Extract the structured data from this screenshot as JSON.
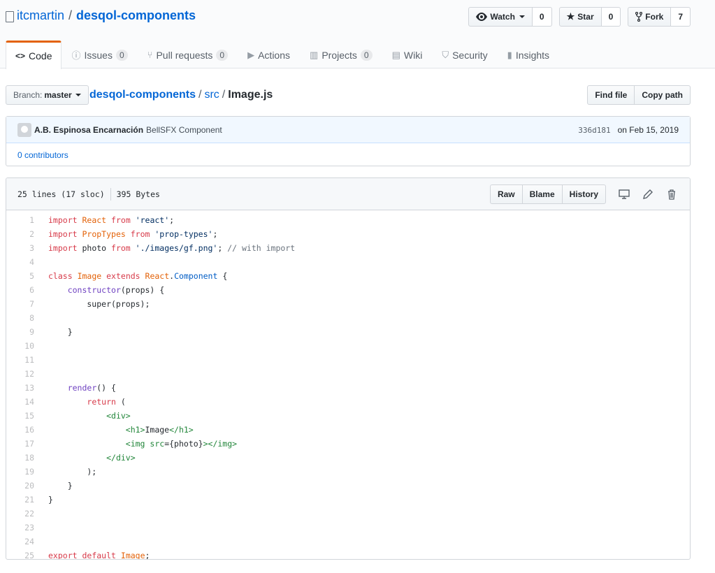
{
  "repo": {
    "owner": "itcmartin",
    "separator": "/",
    "name": "desqol-components"
  },
  "actions": {
    "watch_label": "Watch",
    "watch_count": "0",
    "star_label": "Star",
    "star_count": "0",
    "fork_label": "Fork",
    "fork_count": "7"
  },
  "nav": {
    "code": "Code",
    "issues": "Issues",
    "issues_count": "0",
    "pulls": "Pull requests",
    "pulls_count": "0",
    "actions": "Actions",
    "projects": "Projects",
    "projects_count": "0",
    "wiki": "Wiki",
    "security": "Security",
    "insights": "Insights"
  },
  "branch": {
    "label": "Branch:",
    "value": "master"
  },
  "breadcrumb": {
    "repo": "desqol-components",
    "dir": "src",
    "file": "Image.js",
    "sep": "/"
  },
  "file_nav": {
    "find_file": "Find file",
    "copy_path": "Copy path"
  },
  "commit": {
    "author": "A.B. Espinosa Encarnación",
    "message": "BellSFX Component",
    "sha": "336d181",
    "date": "on Feb 15, 2019",
    "contributors": "0 contributors"
  },
  "file": {
    "lines_info": "25 lines (17 sloc)",
    "size": "395 Bytes",
    "raw": "Raw",
    "blame": "Blame",
    "history": "History"
  },
  "code_lines": [
    "import React from 'react';",
    "import PropTypes from 'prop-types';",
    "import photo from './images/gf.png'; // with import",
    "",
    "class Image extends React.Component {",
    "    constructor(props) {",
    "        super(props);",
    "",
    "    }",
    "",
    "",
    "",
    "    render() {",
    "        return (",
    "            <div>",
    "                <h1>Image</h1>",
    "                <img src={photo}></img>",
    "            </div>",
    "        );",
    "    }",
    "}",
    "",
    "",
    "",
    "export default Image;"
  ],
  "colors": {
    "link": "#0366d6",
    "keyword": "#d73a49",
    "entity": "#e36209",
    "string": "#032f62",
    "comment": "#6a737d",
    "function": "#6f42c1",
    "tag": "#22863a",
    "nav_accent": "#e36209"
  },
  "icons": [
    "repo-icon",
    "eye-icon",
    "star-icon",
    "fork-icon",
    "code-icon",
    "issue-icon",
    "pull-request-icon",
    "play-icon",
    "project-icon",
    "book-icon",
    "shield-icon",
    "graph-icon",
    "desktop-icon",
    "pencil-icon",
    "trash-icon"
  ]
}
